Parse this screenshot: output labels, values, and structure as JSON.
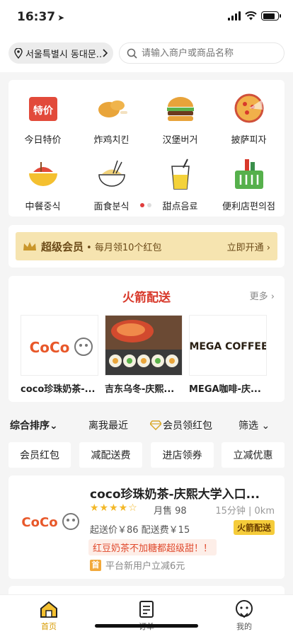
{
  "status": {
    "time": "16:37"
  },
  "topbar": {
    "location": "서울특별시 동대문...",
    "search_placeholder": "请输入商户或商品名称"
  },
  "categories": [
    {
      "label": "今日特价",
      "icon": "daily-deal-icon"
    },
    {
      "label": "炸鸡치킨",
      "icon": "fried-chicken-icon"
    },
    {
      "label": "汉堡버거",
      "icon": "burger-icon"
    },
    {
      "label": "披萨피자",
      "icon": "pizza-icon"
    },
    {
      "label": "中餐중식",
      "icon": "chinese-food-icon"
    },
    {
      "label": "面食분식",
      "icon": "noodle-icon"
    },
    {
      "label": "甜点음료",
      "icon": "drink-icon"
    },
    {
      "label": "便利店편의점",
      "icon": "basket-icon"
    }
  ],
  "member": {
    "title": "超级会员",
    "desc": "• 每月领10个红包",
    "action": "立即开通 ›"
  },
  "rocket": {
    "title": "火箭配送",
    "more": "更多 ›",
    "shops": [
      {
        "name": "coco珍珠奶茶-...",
        "logo_text": "CoCo"
      },
      {
        "name": "吉东乌冬-庆熙...",
        "logo_text": ""
      },
      {
        "name": "MEGA咖啡-庆...",
        "logo_text": "MEGA COFFEE"
      }
    ]
  },
  "sort": {
    "items": [
      "综合排序⌄",
      "离我最近",
      "会员领红包",
      "筛选 ⌄"
    ]
  },
  "chips": [
    "会员红包",
    "减配送费",
    "进店领券",
    "立减优惠"
  ],
  "shop": {
    "name": "coco珍珠奶茶-庆熙大学入口...",
    "stars": "★★★★☆",
    "sales": "月售 98",
    "distance": "15分钟 | 0km",
    "fee": "起送价￥86  配送费￥15",
    "badge": "火箭配送",
    "promo": "红豆奶茶不加糖都超级甜！！",
    "first_icon": "首",
    "first_text": "平台新用户立减6元",
    "logo_text": "CoCo"
  },
  "tabs": [
    {
      "label": "首页",
      "active": true
    },
    {
      "label": "订单",
      "active": false
    },
    {
      "label": "我的",
      "active": false
    }
  ],
  "colors": {
    "accent": "#d8392b",
    "gold": "#f6e4b0",
    "tab_active": "#d89a00"
  }
}
